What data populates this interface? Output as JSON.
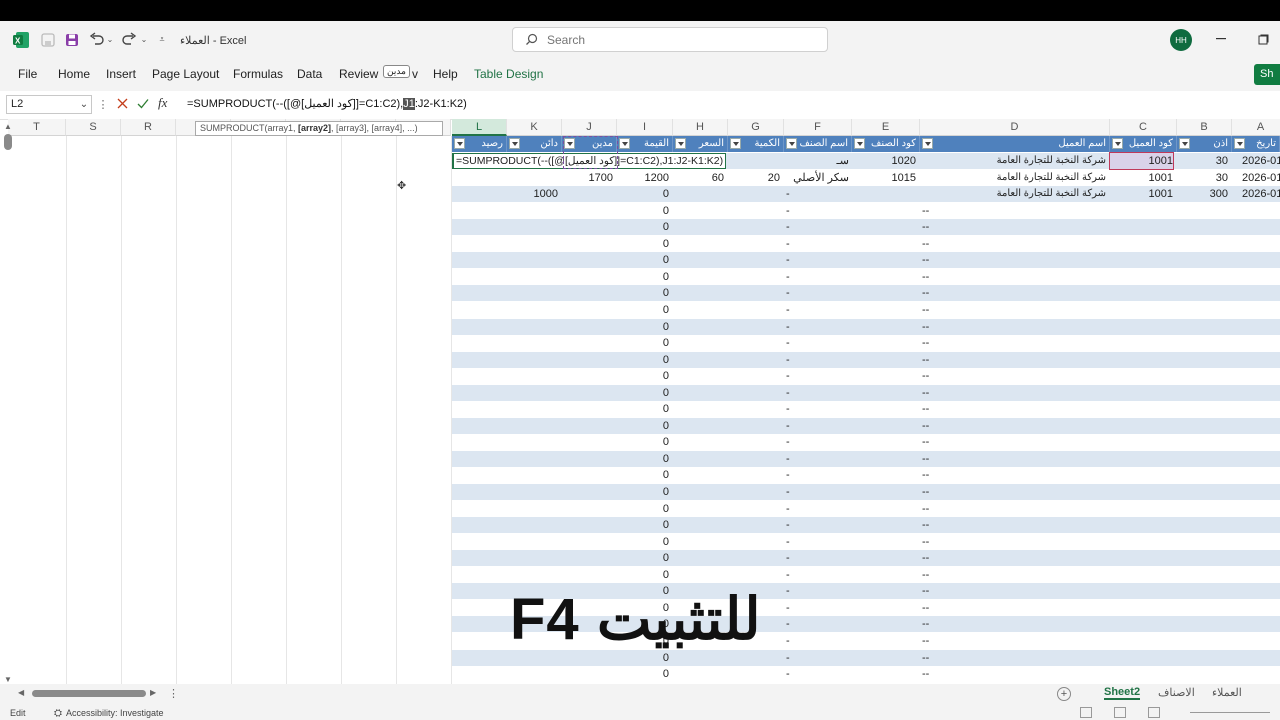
{
  "window": {
    "title": "العملاء  -  Excel"
  },
  "search": {
    "placeholder": "Search"
  },
  "user": {
    "initials": "HH"
  },
  "menu": {
    "file": "File",
    "home": "Home",
    "insert": "Insert",
    "page_layout": "Page Layout",
    "formulas": "Formulas",
    "data": "Data",
    "review": "Review",
    "review_popup": "مدين",
    "view_tail": "v",
    "help": "Help",
    "table_design": "Table Design",
    "share": "Sh"
  },
  "formula_bar": {
    "name_box": "L2",
    "fx": "fx",
    "formula_prefix": "=SUMPRODUCT(--([@[كود العميل]]=C1:C2),",
    "formula_highlight": "J1",
    "formula_suffix": ":J2-K1:K2)"
  },
  "tooltip": {
    "pre": "SUMPRODUCT(array1, ",
    "bold": "[array2]",
    "post": ", [array3], [array4], ...)"
  },
  "columns": [
    "T",
    "S",
    "R",
    "L",
    "K",
    "J",
    "I",
    "H",
    "G",
    "F",
    "E",
    "D",
    "C",
    "B",
    "A"
  ],
  "table_headers": {
    "L": "رصيد",
    "K": "دائن",
    "J": "مدين",
    "I": "القيمة",
    "H": "السعر",
    "G": "الكمية",
    "F": "اسم الصنف",
    "E": "كود الصنف",
    "D": "اسم العميل",
    "C": "كود العميل",
    "B": "اذن",
    "A": "تاريخ"
  },
  "rows": [
    {
      "L": "=SUMPRODUCT(--([@[كود العميل]]=C1:C2),J1:J2-K1:K2)",
      "K": "",
      "J": "",
      "I": "",
      "H": "",
      "G": "",
      "F": "سـ",
      "E": "1020",
      "D": "شركة النخبة للتجارة العامة",
      "C": "1001",
      "B": "30",
      "A": "2026-01"
    },
    {
      "L": "",
      "K": "",
      "J": "1700",
      "I": "1200",
      "H": "60",
      "G": "20",
      "F": "سكر الأصلي",
      "E": "1015",
      "D": "شركة النخبة للتجارة العامة",
      "C": "1001",
      "B": "30",
      "A": "2026-01"
    },
    {
      "L": "",
      "K": "1000",
      "J": "",
      "I": "0",
      "H": "",
      "G": "",
      "F": "-",
      "E": "",
      "D": "شركة النخبة للتجارة العامة",
      "C": "1001",
      "B": "300",
      "A": "2026-01"
    }
  ],
  "filler": {
    "I": "0",
    "F": "-",
    "E": "--"
  },
  "sheets": [
    "Sheet2",
    "الاصناف",
    "العملاء"
  ],
  "status": {
    "mode": "Edit",
    "accessibility": "Accessibility: Investigate"
  },
  "overlay_text": "F4 للتثبيت",
  "colors": {
    "table_header": "#4f81bd",
    "band": "#dce6f1",
    "accent": "#217346"
  }
}
